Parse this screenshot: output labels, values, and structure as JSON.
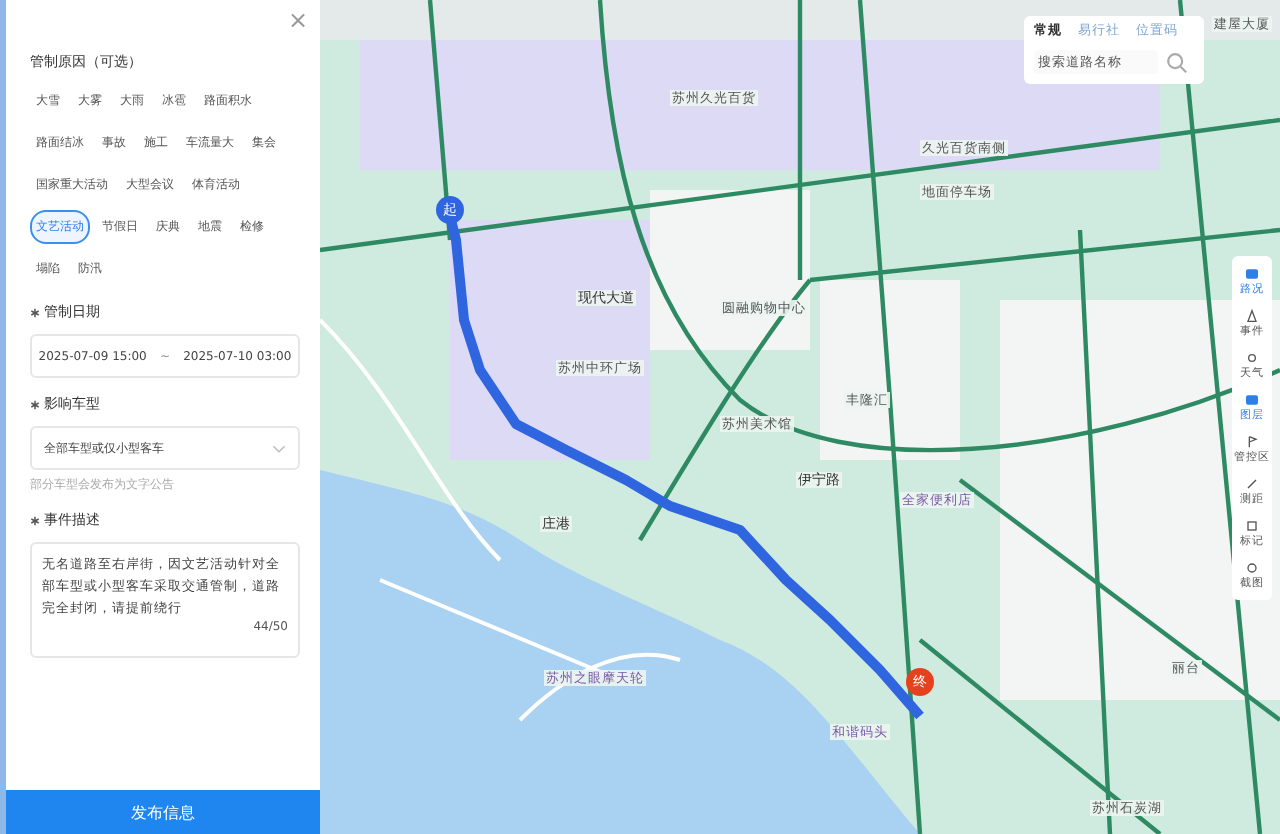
{
  "panel": {
    "close": "×",
    "reason": {
      "label": "管制原因（可选）",
      "tags": [
        {
          "label": "大雪",
          "selected": false
        },
        {
          "label": "大雾",
          "selected": false
        },
        {
          "label": "大雨",
          "selected": false
        },
        {
          "label": "冰雹",
          "selected": false
        },
        {
          "label": "路面积水",
          "selected": false
        },
        {
          "label": "路面结冰",
          "selected": false
        },
        {
          "label": "事故",
          "selected": false
        },
        {
          "label": "施工",
          "selected": false
        },
        {
          "label": "车流量大",
          "selected": false
        },
        {
          "label": "集会",
          "selected": false
        },
        {
          "label": "国家重大活动",
          "selected": false
        },
        {
          "label": "大型会议",
          "selected": false
        },
        {
          "label": "体育活动",
          "selected": false
        },
        {
          "label": "文艺活动",
          "selected": true
        },
        {
          "label": "节假日",
          "selected": false
        },
        {
          "label": "庆典",
          "selected": false
        },
        {
          "label": "地震",
          "selected": false
        },
        {
          "label": "检修",
          "selected": false
        },
        {
          "label": "塌陷",
          "selected": false
        },
        {
          "label": "防汛",
          "selected": false
        }
      ]
    },
    "date": {
      "label": "管制日期",
      "required": true,
      "start": "2025-07-09 15:00",
      "separator": "~",
      "end": "2025-07-10 03:00"
    },
    "vehicle": {
      "label": "影响车型",
      "required": true,
      "value": "全部车型或仅小型客车",
      "hint": "部分车型会发布为文字公告"
    },
    "description": {
      "label": "事件描述",
      "required": true,
      "text": "无名道路至右岸街，因文艺活动针对全部车型或小型客车采取交通管制，道路完全封闭，请提前绕行",
      "counter": "44/50"
    },
    "submit": "发布信息"
  },
  "map": {
    "tabs": [
      {
        "label": "常规",
        "selected": true
      },
      {
        "label": "易行社",
        "selected": false
      },
      {
        "label": "位置码",
        "selected": false
      }
    ],
    "search": {
      "placeholder": "搜索道路名称"
    },
    "toolbar": [
      {
        "label": "路况",
        "selected": true
      },
      {
        "label": "事件",
        "selected": false
      },
      {
        "label": "天气",
        "selected": false
      },
      {
        "label": "图层",
        "selected": true
      },
      {
        "label": "管控区",
        "selected": false
      },
      {
        "label": "测距",
        "selected": false
      },
      {
        "label": "标记",
        "selected": false
      },
      {
        "label": "截图",
        "selected": false
      }
    ],
    "labels": [
      {
        "text": "苏州久光百货",
        "kind": "area"
      },
      {
        "text": "建屋大厦",
        "kind": "area"
      },
      {
        "text": "现代大道",
        "kind": "road"
      },
      {
        "text": "久光百货南侧",
        "kind": "area"
      },
      {
        "text": "地面停车场",
        "kind": "area"
      },
      {
        "text": "圆融购物中心",
        "kind": "area"
      },
      {
        "text": "苏州中环广场",
        "kind": "area"
      },
      {
        "text": "苏州美术馆",
        "kind": "area"
      },
      {
        "text": "丰隆汇",
        "kind": "area"
      },
      {
        "text": "伊宁路",
        "kind": "road"
      },
      {
        "text": "全家便利店",
        "kind": "poi"
      },
      {
        "text": "庄港",
        "kind": "road"
      },
      {
        "text": "苏州之眼摩天轮",
        "kind": "poi"
      },
      {
        "text": "和谐码头",
        "kind": "poi"
      },
      {
        "text": "苏州石炭湖",
        "kind": "area"
      },
      {
        "text": "丽台",
        "kind": "area"
      }
    ],
    "route": {
      "start": "起",
      "end": "终"
    }
  }
}
